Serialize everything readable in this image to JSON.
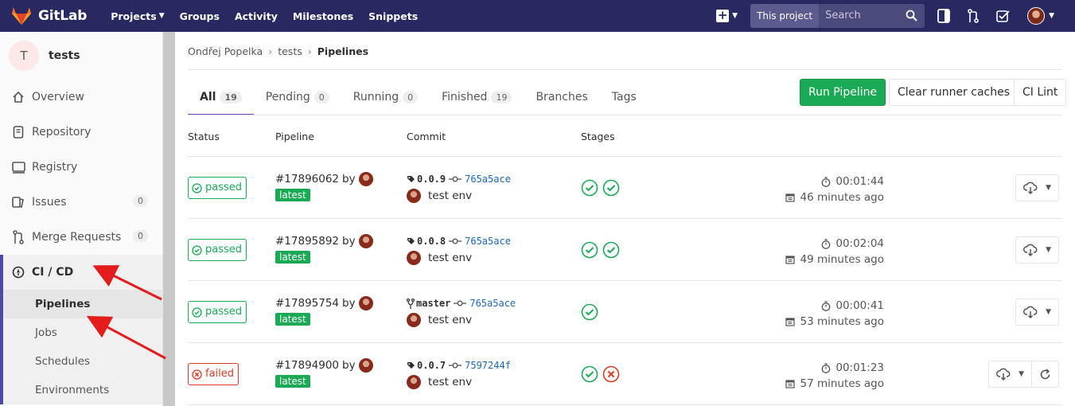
{
  "topbar": {
    "brand": "GitLab",
    "nav": [
      {
        "label": "Projects",
        "has_caret": true
      },
      {
        "label": "Groups"
      },
      {
        "label": "Activity"
      },
      {
        "label": "Milestones"
      },
      {
        "label": "Snippets"
      }
    ],
    "search_scope": "This project",
    "search_placeholder": "Search"
  },
  "sidebar": {
    "project_initial": "T",
    "project_name": "tests",
    "items": [
      {
        "label": "Overview",
        "icon": "home-icon"
      },
      {
        "label": "Repository",
        "icon": "doc-icon"
      },
      {
        "label": "Registry",
        "icon": "container-icon"
      },
      {
        "label": "Issues",
        "icon": "issues-icon",
        "count": "0"
      },
      {
        "label": "Merge Requests",
        "icon": "merge-request-icon",
        "count": "0"
      },
      {
        "label": "CI / CD",
        "icon": "rocket-icon",
        "active": true
      }
    ],
    "cicd_sub": [
      "Pipelines",
      "Jobs",
      "Schedules",
      "Environments"
    ]
  },
  "breadcrumb": [
    "Ondřej Popelka",
    "tests",
    "Pipelines"
  ],
  "tabs": [
    {
      "label": "All",
      "count": "19",
      "active": true
    },
    {
      "label": "Pending",
      "count": "0"
    },
    {
      "label": "Running",
      "count": "0"
    },
    {
      "label": "Finished",
      "count": "19"
    },
    {
      "label": "Branches"
    },
    {
      "label": "Tags"
    }
  ],
  "buttons": {
    "run_pipeline": "Run Pipeline",
    "clear_caches": "Clear runner caches",
    "ci_lint": "CI Lint"
  },
  "table": {
    "headers": [
      "Status",
      "Pipeline",
      "Commit",
      "Stages"
    ],
    "rows": [
      {
        "status": "passed",
        "id": "#17896062",
        "by": "by",
        "tag": "latest",
        "ref_type": "tag",
        "ref": "0.0.9",
        "sha": "765a5ace",
        "message": "test env",
        "stages": [
          "success",
          "success"
        ],
        "duration": "00:01:44",
        "finished": "46 minutes ago",
        "retry": false
      },
      {
        "status": "passed",
        "id": "#17895892",
        "by": "by",
        "tag": "latest",
        "ref_type": "tag",
        "ref": "0.0.8",
        "sha": "765a5ace",
        "message": "test env",
        "stages": [
          "success",
          "success"
        ],
        "duration": "00:02:04",
        "finished": "49 minutes ago",
        "retry": false
      },
      {
        "status": "passed",
        "id": "#17895754",
        "by": "by",
        "tag": "latest",
        "ref_type": "branch",
        "ref": "master",
        "sha": "765a5ace",
        "message": "test env",
        "stages": [
          "success"
        ],
        "duration": "00:00:41",
        "finished": "53 minutes ago",
        "retry": false
      },
      {
        "status": "failed",
        "id": "#17894900",
        "by": "by",
        "tag": "latest",
        "ref_type": "tag",
        "ref": "0.0.7",
        "sha": "7597244f",
        "message": "test env",
        "stages": [
          "success",
          "failed"
        ],
        "duration": "00:01:23",
        "finished": "57 minutes ago",
        "retry": true
      }
    ]
  },
  "colors": {
    "topbar": "#292961",
    "success": "#1aaa55",
    "failed": "#db3b21",
    "link": "#1b69b6",
    "annotation": "#e51c1c"
  }
}
